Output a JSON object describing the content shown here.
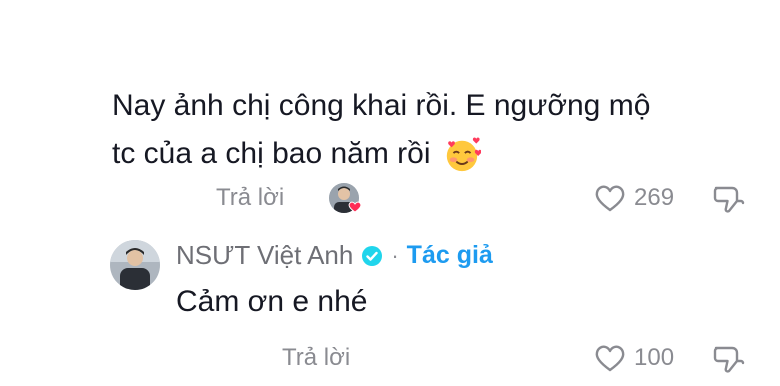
{
  "comment": {
    "line1": "Nay ảnh chị công khai rồi. E ngưỡng mộ",
    "line2": "tc của a chị bao năm rồi",
    "emoji_icon": "smiling-face-with-hearts-icon",
    "reply_label": "Trả lời",
    "like_count": "269"
  },
  "reply": {
    "author": "NSƯT Việt Anh",
    "separator": "·",
    "author_tag": "Tác giả",
    "text": "Cảm ơn e nhé",
    "reply_label": "Trả lời",
    "like_count": "100"
  },
  "colors": {
    "text": "#161823",
    "muted": "#8a8b91",
    "accent": "#1d9bf0",
    "heart": "#fe2c55"
  }
}
